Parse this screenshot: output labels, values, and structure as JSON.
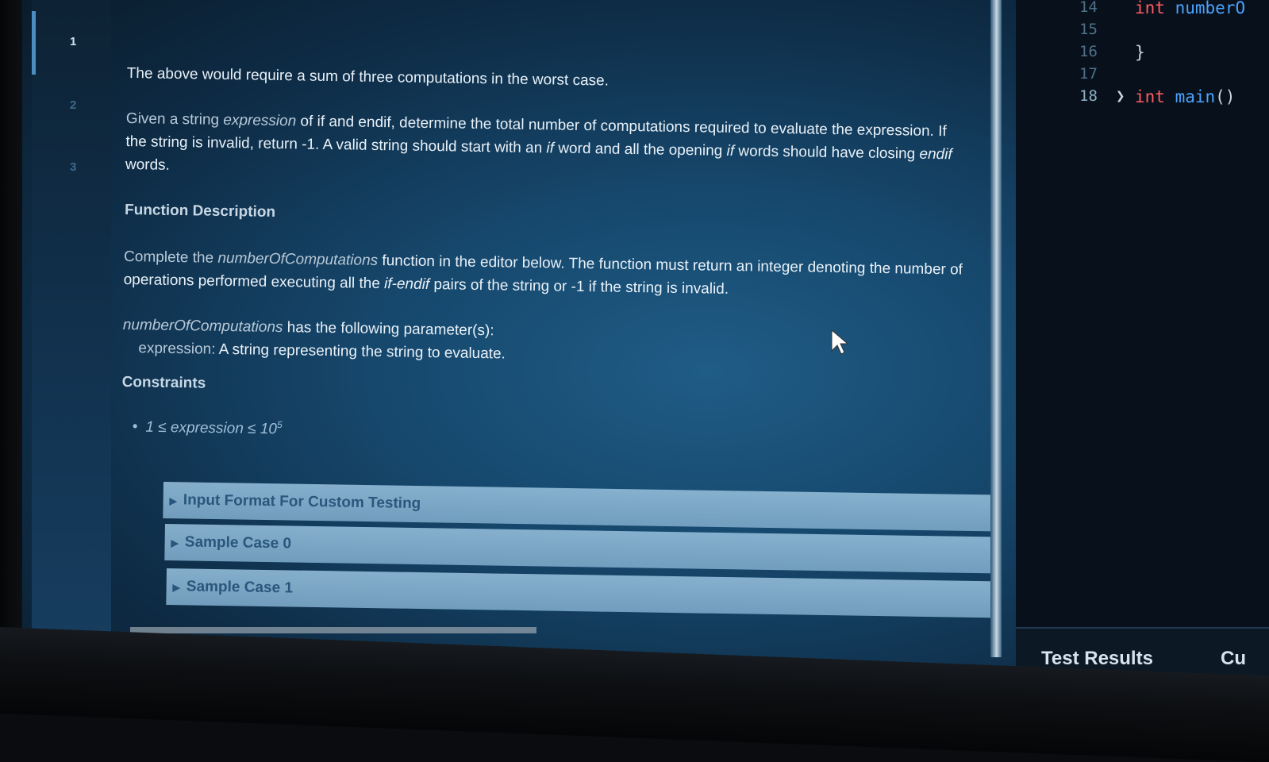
{
  "gutter": {
    "numbers": [
      "1",
      "2",
      "3"
    ]
  },
  "problem": {
    "worst_case": "The above would require a sum of three computations in the worst case.",
    "given_1": "Given a string ",
    "given_expr": "expression",
    "given_2": " of if and endif, determine the total number of computations required to evaluate the expression. If the string is invalid, return -1. A valid string should start with an ",
    "given_if1": "if",
    "given_3": " word and all the opening ",
    "given_if2": "if",
    "given_4": " words should have closing ",
    "given_endif": "endif",
    "given_5": " words.",
    "func_desc_heading": "Function Description",
    "complete_1": "Complete the ",
    "complete_fn": "numberOfComputations",
    "complete_2": " function in the editor below. The function must return an integer denoting the number of operations performed executing all the ",
    "complete_pairs": "if-endif",
    "complete_3": " pairs of the string or -1 if the string is invalid.",
    "params_fn": "numberOfComputations",
    "params_text": " has the following parameter(s):",
    "param_name": "expression:",
    "param_desc": " A string representing the string to evaluate.",
    "constraints_heading": "Constraints",
    "constraint_bullet": "•",
    "constraint_text": "1 ≤ expression ≤ 10",
    "constraint_exp": "5"
  },
  "sections": [
    {
      "label": "Input Format For Custom Testing"
    },
    {
      "label": "Sample Case 0"
    },
    {
      "label": "Sample Case 1"
    }
  ],
  "editor": {
    "lines": [
      {
        "num": "14",
        "kw": "int",
        "rest": " numberO"
      },
      {
        "num": "15"
      },
      {
        "num": "16",
        "plain": "}"
      },
      {
        "num": "17"
      },
      {
        "num": "18",
        "kw": "int",
        "fn": " main",
        "plain": "()"
      }
    ]
  },
  "bottom_tabs": {
    "test_results": "Test Results",
    "custom": "Cu"
  },
  "colors": {
    "keyword": "#ff5b62",
    "function": "#4aa3ff",
    "accent_bar": "#4b8dc0"
  }
}
